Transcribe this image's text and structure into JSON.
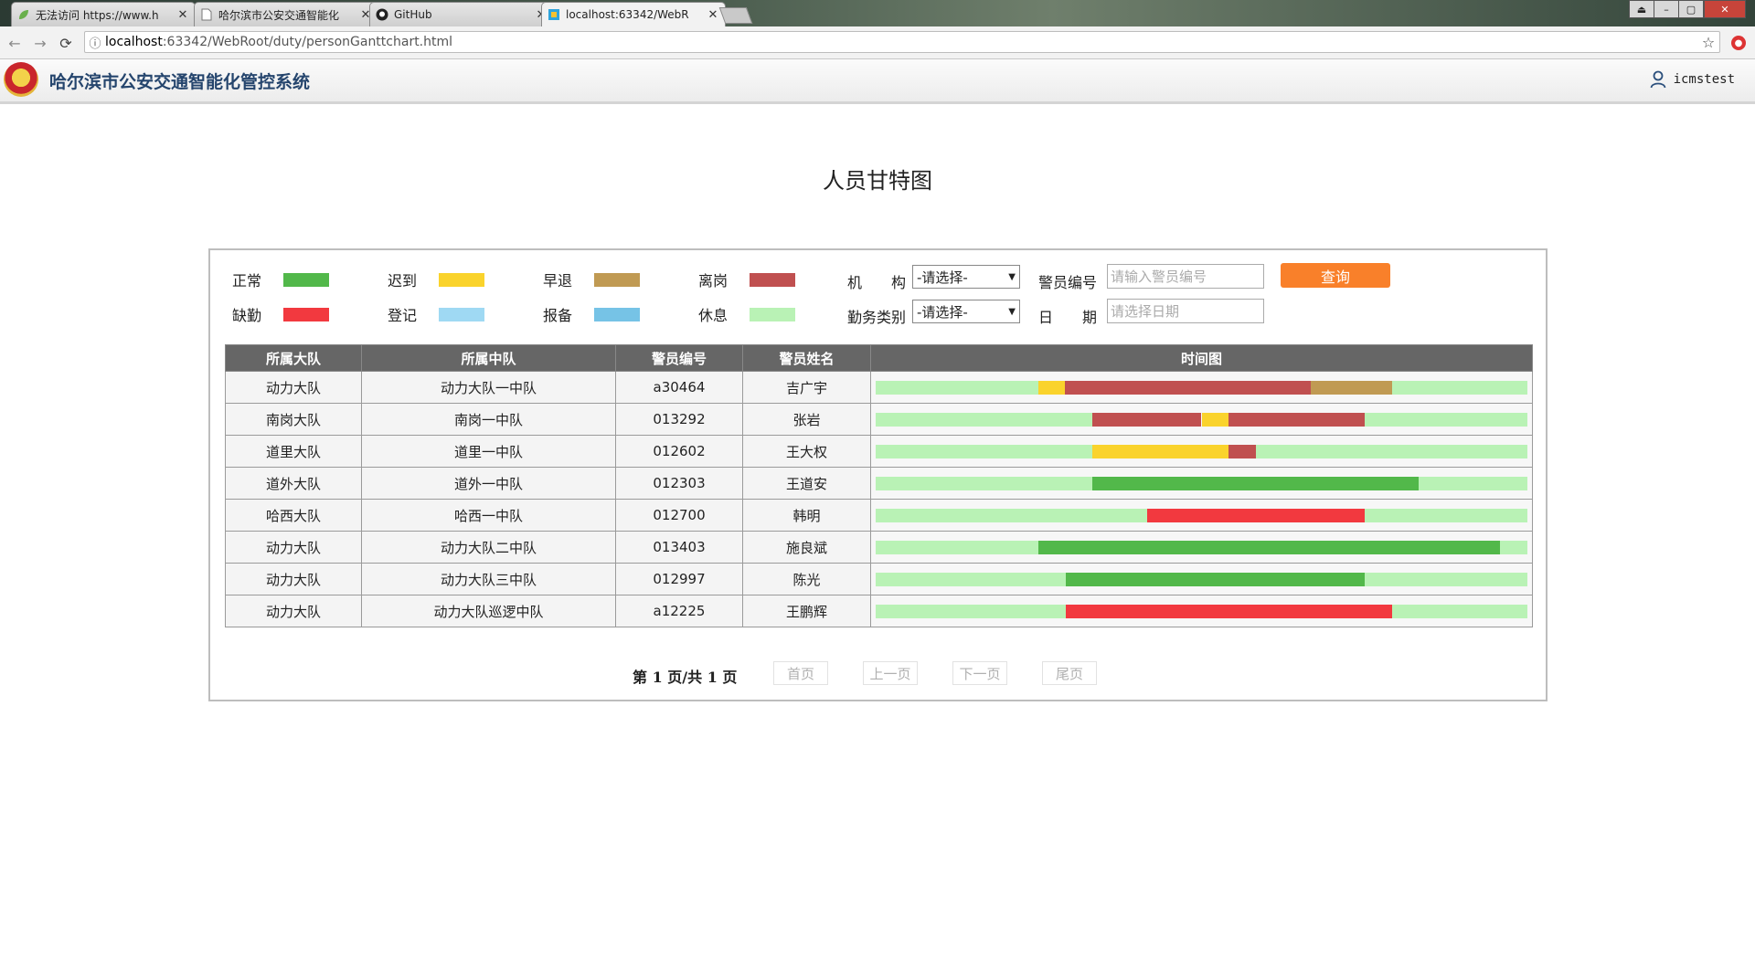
{
  "browser": {
    "tabs": [
      {
        "title": "无法访问 https://www.h",
        "icon": "leaf-icon"
      },
      {
        "title": "哈尔滨市公安交通智能化",
        "icon": "page-icon"
      },
      {
        "title": "GitHub",
        "icon": "github-icon"
      },
      {
        "title": "localhost:63342/WebR",
        "icon": "webstorm-icon",
        "active": true
      }
    ],
    "url_host": "localhost",
    "url_path": ":63342/WebRoot/duty/personGanttchart.html"
  },
  "app": {
    "title": "哈尔滨市公安交通智能化管控系统",
    "username": "icmstest"
  },
  "page_title": "人员甘特图",
  "legend": [
    {
      "label": "正常",
      "color": "#52b84a"
    },
    {
      "label": "迟到",
      "color": "#fad32c"
    },
    {
      "label": "早退",
      "color": "#c09a53"
    },
    {
      "label": "离岗",
      "color": "#c05050"
    },
    {
      "label": "缺勤",
      "color": "#f2393f"
    },
    {
      "label": "登记",
      "color": "#9fd9f3"
    },
    {
      "label": "报备",
      "color": "#76c3e6"
    },
    {
      "label": "休息",
      "color": "#b9f2b5"
    }
  ],
  "filters": {
    "org_label": "机　　构",
    "org_value": "-请选择-",
    "duty_label": "勤务类别",
    "duty_value": "-请选择-",
    "police_no_label": "警员编号",
    "police_no_placeholder": "请输入警员编号",
    "date_label": "日　　期",
    "date_placeholder": "请选择日期",
    "query_label": "查询"
  },
  "table": {
    "headers": [
      "所属大队",
      "所属中队",
      "警员编号",
      "警员姓名",
      "时间图"
    ],
    "rows": [
      {
        "brigade": "动力大队",
        "squad": "动力大队一中队",
        "id": "a30464",
        "name": "吉广宇",
        "segments": [
          {
            "s": "休息",
            "a": 0,
            "b": 0.25
          },
          {
            "s": "迟到",
            "a": 0.25,
            "b": 0.29
          },
          {
            "s": "离岗",
            "a": 0.29,
            "b": 0.667
          },
          {
            "s": "早退",
            "a": 0.667,
            "b": 0.792
          },
          {
            "s": "休息",
            "a": 0.792,
            "b": 1
          }
        ]
      },
      {
        "brigade": "南岗大队",
        "squad": "南岗一中队",
        "id": "013292",
        "name": "张岩",
        "segments": [
          {
            "s": "休息",
            "a": 0,
            "b": 0.333
          },
          {
            "s": "离岗",
            "a": 0.333,
            "b": 0.5
          },
          {
            "s": "迟到",
            "a": 0.5,
            "b": 0.542
          },
          {
            "s": "离岗",
            "a": 0.542,
            "b": 0.75
          },
          {
            "s": "休息",
            "a": 0.75,
            "b": 1
          }
        ]
      },
      {
        "brigade": "道里大队",
        "squad": "道里一中队",
        "id": "012602",
        "name": "王大权",
        "segments": [
          {
            "s": "休息",
            "a": 0,
            "b": 0.333
          },
          {
            "s": "迟到",
            "a": 0.333,
            "b": 0.542
          },
          {
            "s": "离岗",
            "a": 0.542,
            "b": 0.583
          },
          {
            "s": "休息",
            "a": 0.583,
            "b": 1
          }
        ]
      },
      {
        "brigade": "道外大队",
        "squad": "道外一中队",
        "id": "012303",
        "name": "王道安",
        "segments": [
          {
            "s": "休息",
            "a": 0,
            "b": 0.333
          },
          {
            "s": "正常",
            "a": 0.333,
            "b": 0.833
          },
          {
            "s": "休息",
            "a": 0.833,
            "b": 1
          }
        ]
      },
      {
        "brigade": "哈西大队",
        "squad": "哈西一中队",
        "id": "012700",
        "name": "韩明",
        "segments": [
          {
            "s": "休息",
            "a": 0,
            "b": 0.417
          },
          {
            "s": "缺勤",
            "a": 0.417,
            "b": 0.75
          },
          {
            "s": "休息",
            "a": 0.75,
            "b": 1
          }
        ]
      },
      {
        "brigade": "动力大队",
        "squad": "动力大队二中队",
        "id": "013403",
        "name": "施良斌",
        "segments": [
          {
            "s": "休息",
            "a": 0,
            "b": 0.25
          },
          {
            "s": "正常",
            "a": 0.25,
            "b": 0.958
          },
          {
            "s": "休息",
            "a": 0.958,
            "b": 1
          }
        ]
      },
      {
        "brigade": "动力大队",
        "squad": "动力大队三中队",
        "id": "012997",
        "name": "陈光",
        "segments": [
          {
            "s": "休息",
            "a": 0,
            "b": 0.292
          },
          {
            "s": "正常",
            "a": 0.292,
            "b": 0.75
          },
          {
            "s": "休息",
            "a": 0.75,
            "b": 1
          }
        ]
      },
      {
        "brigade": "动力大队",
        "squad": "动力大队巡逻中队",
        "id": "a12225",
        "name": "王鹏辉",
        "segments": [
          {
            "s": "休息",
            "a": 0,
            "b": 0.292
          },
          {
            "s": "缺勤",
            "a": 0.292,
            "b": 0.792
          },
          {
            "s": "休息",
            "a": 0.792,
            "b": 1
          }
        ]
      }
    ]
  },
  "pager": {
    "info": "第 1 页/共 1 页",
    "first": "首页",
    "prev": "上一页",
    "next": "下一页",
    "last": "尾页"
  }
}
